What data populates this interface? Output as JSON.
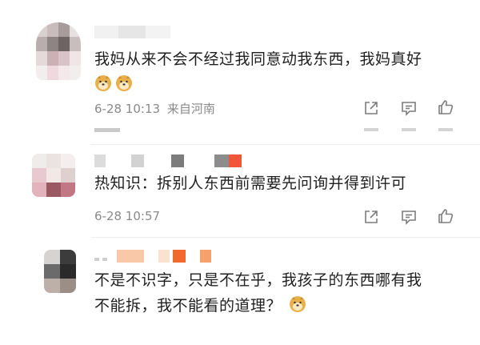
{
  "comments": [
    {
      "text_lines": [
        "我妈从来不会不经过我同意动我东西，我妈真好"
      ],
      "emojis": [
        "doge-emoji",
        "doge-emoji"
      ],
      "time": "6-28 10:13",
      "location": "来自河南",
      "actions": [
        "share-icon",
        "comment-icon",
        "like-icon"
      ]
    },
    {
      "text_lines": [
        "热知识：拆别人东西前需要先问询并得到许可"
      ],
      "emojis": [],
      "time": "6-28 10:57",
      "location": "",
      "actions": [
        "share-icon",
        "comment-icon",
        "like-icon"
      ]
    },
    {
      "text_lines": [
        "不是不识字，只是不在乎，我孩子的东西哪有我",
        "不能拆，我不能看的道理？"
      ],
      "emojis": [
        "doge-emoji"
      ],
      "time": "",
      "location": "",
      "actions": []
    }
  ],
  "colors": {
    "text": "#1f1f1f",
    "meta": "#8a8a8a",
    "icon": "#7d7d7d",
    "doge": "#e8b04a"
  }
}
